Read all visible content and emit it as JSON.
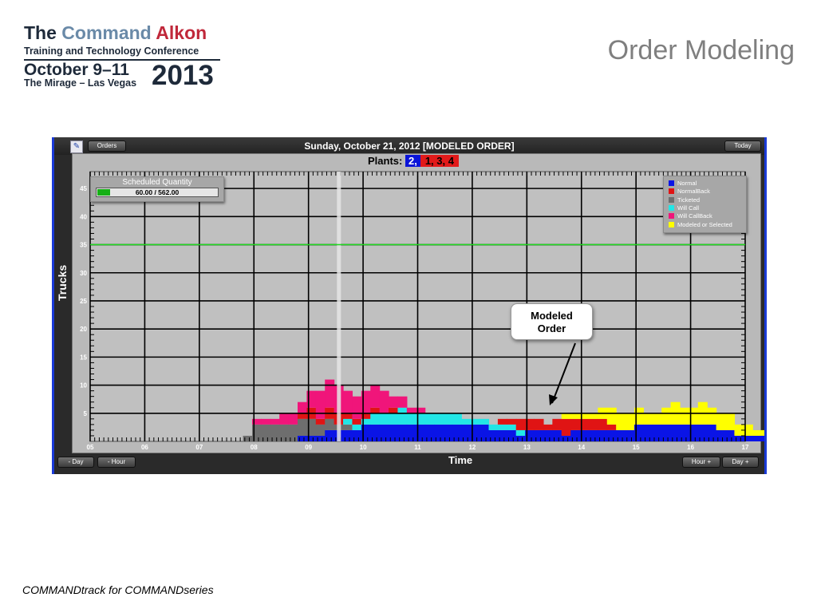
{
  "slide": {
    "logo": {
      "line1_a": "The ",
      "line1_b": "Command",
      "line1_c": " Alkon",
      "line2": "Training and Technology Conference",
      "line3": "October 9–11",
      "line4": "The Mirage – Las Vegas",
      "year": "2013"
    },
    "title": "Order Modeling",
    "footer": "COMMANDtrack for COMMANDseries"
  },
  "app": {
    "orders_label": "Orders",
    "today_label": "Today",
    "window_title": "Sunday, October 21, 2012 [MODELED ORDER]",
    "plants_label": "Plants:",
    "plant_selected": "2,",
    "plant_others": "1,  3,  4",
    "scheduled_title": "Scheduled Quantity",
    "scheduled_value": "60.00 / 562.00",
    "scheduled_fraction": 0.107,
    "buttons": {
      "minus_day": "- Day",
      "minus_hour": "- Hour",
      "hour_plus": "Hour +",
      "day_plus": "Day +"
    },
    "callout": {
      "line1": "Modeled",
      "line2": "Order"
    },
    "colors": {
      "normal": "#0a14e6",
      "normalback": "#e01414",
      "ticketed": "#6e6e6e",
      "willcall": "#22e6e6",
      "willcallback": "#f0157a",
      "modeled": "#ffff00",
      "threshold": "#22dd22"
    }
  },
  "chart_data": {
    "type": "area",
    "xlabel": "Time",
    "ylabel": "Trucks",
    "x_ticks": [
      "05",
      "06",
      "07",
      "08",
      "09",
      "10",
      "11",
      "12",
      "13",
      "14",
      "15",
      "16",
      "17"
    ],
    "y_ticks": [
      "5",
      "10",
      "15",
      "20",
      "25",
      "30",
      "35",
      "40",
      "45"
    ],
    "xlim": [
      5,
      17
    ],
    "ylim": [
      0,
      48
    ],
    "threshold_line": 35,
    "current_time_marker": 9.55,
    "legend": [
      "Normal",
      "NormalBack",
      "Ticketed",
      "Will Call",
      "Will CallBack",
      "Modeled or Selected"
    ],
    "bins_start": 7.8,
    "bin_hours": 0.1667,
    "series": [
      {
        "name": "Normal",
        "key": "normal",
        "values": [
          0,
          0,
          0,
          0,
          0,
          0,
          1,
          1,
          1,
          2,
          2,
          2,
          2,
          3,
          3,
          3,
          3,
          3,
          3,
          3,
          3,
          3,
          3,
          3,
          3,
          3,
          3,
          2,
          2,
          2,
          1,
          2,
          2,
          2,
          2,
          1,
          2,
          2,
          2,
          2,
          2,
          2,
          2,
          3,
          3,
          3,
          3,
          3,
          3,
          3,
          3,
          3,
          2,
          2,
          1,
          1,
          1,
          1,
          1,
          1,
          0
        ]
      },
      {
        "name": "Ticketed",
        "key": "ticketed",
        "values": [
          1,
          3,
          3,
          3,
          3,
          3,
          3,
          3,
          2,
          2,
          1,
          1,
          0,
          0,
          0,
          0,
          0,
          0,
          0,
          0,
          0,
          0,
          0,
          0,
          0,
          0,
          0,
          0,
          0,
          0,
          0,
          0,
          0,
          0,
          0,
          0,
          0,
          0,
          0,
          0,
          0,
          0,
          0,
          0,
          0,
          0,
          0,
          0,
          0,
          0,
          0,
          0,
          0,
          0,
          0,
          0,
          0,
          0,
          0,
          0,
          0
        ]
      },
      {
        "name": "Will Call",
        "key": "willcall",
        "values": [
          0,
          0,
          0,
          0,
          0,
          0,
          0,
          0,
          0,
          0,
          0,
          1,
          1,
          1,
          2,
          2,
          2,
          3,
          2,
          2,
          2,
          2,
          2,
          2,
          1,
          1,
          1,
          1,
          1,
          1,
          1,
          0,
          0,
          0,
          0,
          0,
          0,
          0,
          0,
          0,
          0,
          0,
          0,
          0,
          0,
          0,
          0,
          0,
          0,
          0,
          0,
          0,
          0,
          0,
          0,
          0,
          0,
          0,
          0,
          0,
          0
        ]
      },
      {
        "name": "NormalBack",
        "key": "normalback",
        "values": [
          0,
          0,
          0,
          0,
          0,
          0,
          1,
          2,
          1,
          2,
          2,
          1,
          1,
          1,
          1,
          0,
          1,
          0,
          0,
          0,
          0,
          0,
          0,
          0,
          0,
          0,
          0,
          0,
          1,
          1,
          2,
          2,
          2,
          1,
          2,
          3,
          2,
          2,
          2,
          2,
          1,
          0,
          0,
          0,
          0,
          0,
          0,
          0,
          0,
          0,
          0,
          0,
          0,
          0,
          0,
          0,
          0,
          0,
          0,
          0,
          0
        ]
      },
      {
        "name": "Will CallBack",
        "key": "willcallback",
        "values": [
          0,
          1,
          1,
          1,
          2,
          2,
          2,
          3,
          5,
          5,
          5,
          4,
          4,
          4,
          4,
          4,
          2,
          2,
          1,
          1,
          0,
          0,
          0,
          0,
          0,
          0,
          0,
          0,
          0,
          0,
          0,
          0,
          0,
          0,
          0,
          0,
          0,
          0,
          0,
          0,
          0,
          0,
          0,
          0,
          0,
          0,
          0,
          0,
          0,
          0,
          0,
          0,
          0,
          0,
          0,
          0,
          0,
          0,
          0,
          0,
          0
        ]
      },
      {
        "name": "Modeled or Selected",
        "key": "modeled",
        "values": [
          0,
          0,
          0,
          0,
          0,
          0,
          0,
          0,
          0,
          0,
          0,
          0,
          0,
          0,
          0,
          0,
          0,
          0,
          0,
          0,
          0,
          0,
          0,
          0,
          0,
          0,
          0,
          0,
          0,
          0,
          0,
          0,
          0,
          0,
          0,
          1,
          1,
          1,
          1,
          2,
          3,
          3,
          3,
          3,
          2,
          2,
          3,
          4,
          3,
          3,
          4,
          3,
          3,
          3,
          2,
          2,
          1,
          1,
          0,
          0,
          0
        ]
      }
    ]
  }
}
